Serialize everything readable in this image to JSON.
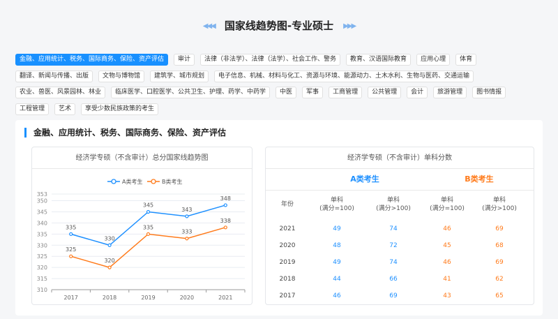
{
  "page_title": "国家线趋势图-专业硕士",
  "tags": [
    [
      "金融、应用统计、税务、国际商务、保险、资产评估",
      "审计",
      "法律（非法学）、法律（法学）、社会工作、警务",
      "教育、汉语国际教育",
      "应用心理",
      "体育"
    ],
    [
      "翻译、新闻与传播、出版",
      "文物与博物馆",
      "建筑学、城市规划",
      "电子信息、机械、材料与化工、资源与环境、能源动力、土木水利、生物与医药、交通运输"
    ],
    [
      "农业、兽医、风景园林、林业",
      "临床医学、口腔医学、公共卫生、护理、药学、中药学",
      "中医",
      "军事",
      "工商管理",
      "公共管理",
      "会计",
      "旅游管理",
      "图书情报"
    ],
    [
      "工程管理",
      "艺术",
      "享受少数民族政策的考生"
    ]
  ],
  "section_title": "金融、应用统计、税务、国际商务、保险、资产评估",
  "colors": {
    "a": "#1e90ff",
    "b": "#ff7a1a",
    "accent": "#1890ff"
  },
  "chart_data": {
    "type": "line",
    "title": "经济学专硕（不含审计）总分国家线趋势图",
    "categories": [
      "2017",
      "2018",
      "2019",
      "2020",
      "2021"
    ],
    "series": [
      {
        "name": "A类考生",
        "values": [
          335,
          330,
          345,
          343,
          348
        ]
      },
      {
        "name": "B类考生",
        "values": [
          325,
          320,
          335,
          333,
          338
        ]
      }
    ],
    "yticks": [
      310,
      315,
      320,
      325,
      330,
      335,
      340,
      345,
      350,
      353
    ],
    "ylim": [
      310,
      353
    ],
    "legend": "top-center"
  },
  "table": {
    "title": "经济学专硕（不含审计）单科分数",
    "group_a": "A类考生",
    "group_b": "B类考生",
    "headers": [
      "年份",
      "单科\n(满分=100)",
      "单科\n(满分>100)",
      "单科\n(满分=100)",
      "单科\n(满分>100)"
    ],
    "rows": [
      [
        "2021",
        "49",
        "74",
        "46",
        "69"
      ],
      [
        "2020",
        "48",
        "72",
        "45",
        "68"
      ],
      [
        "2019",
        "49",
        "74",
        "46",
        "69"
      ],
      [
        "2018",
        "44",
        "66",
        "41",
        "62"
      ],
      [
        "2017",
        "46",
        "69",
        "43",
        "65"
      ]
    ]
  }
}
